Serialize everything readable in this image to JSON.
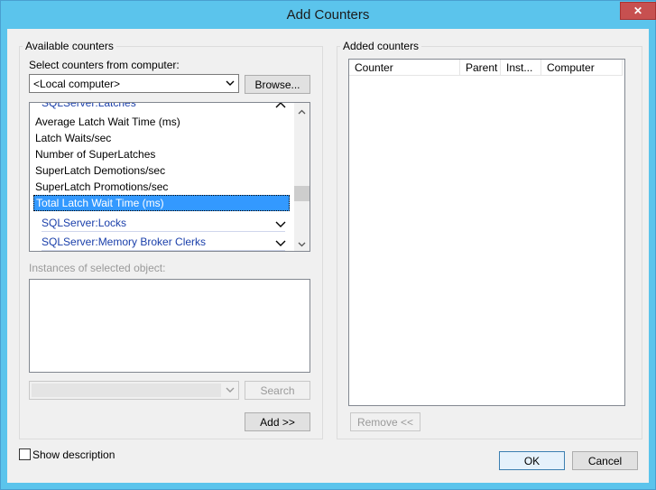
{
  "window": {
    "title": "Add Counters",
    "close_glyph": "✕"
  },
  "available": {
    "group_label": "Available counters",
    "select_label": "Select counters from computer:",
    "computer_value": "<Local computer>",
    "browse_label": "Browse...",
    "partial_object": "SQLServer:Latches",
    "counters": [
      {
        "label": "Average Latch Wait Time (ms)",
        "selected": false
      },
      {
        "label": "Latch Waits/sec",
        "selected": false
      },
      {
        "label": "Number of SuperLatches",
        "selected": false
      },
      {
        "label": "SuperLatch Demotions/sec",
        "selected": false
      },
      {
        "label": "SuperLatch Promotions/sec",
        "selected": false
      },
      {
        "label": "Total Latch Wait Time (ms)",
        "selected": true
      }
    ],
    "objects": [
      {
        "label": "SQLServer:Locks"
      },
      {
        "label": "SQLServer:Memory Broker Clerks"
      }
    ],
    "instances_label": "Instances of selected object:",
    "search_value": "",
    "search_label": "Search",
    "add_label": "Add >>"
  },
  "added": {
    "group_label": "Added counters",
    "columns": [
      "Counter",
      "Parent",
      "Inst...",
      "Computer"
    ],
    "rows": [],
    "remove_label": "Remove <<"
  },
  "footer": {
    "show_description_label": "Show description",
    "show_description_checked": false,
    "ok_label": "OK",
    "cancel_label": "Cancel"
  },
  "icons": {
    "chevron_down": "chevron-down-icon",
    "chevron_up": "chevron-up-icon",
    "close": "close-icon"
  }
}
